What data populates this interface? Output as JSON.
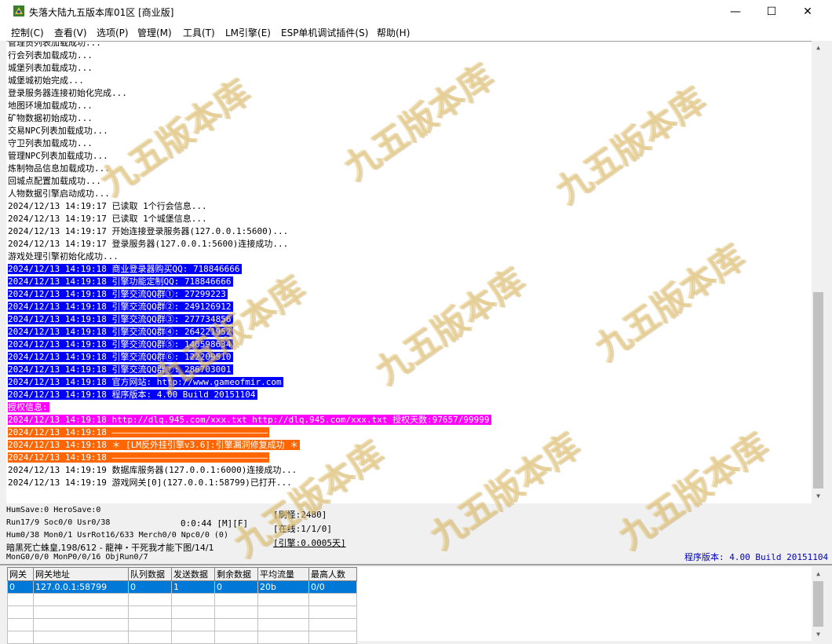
{
  "window": {
    "title": "失落大陆九五版本库01区 [商业版]",
    "controls": {
      "minimize": "—",
      "maximize": "☐",
      "close": "✕"
    }
  },
  "menu": [
    "控制(C)",
    "查看(V)",
    "选项(P)",
    "管理(M)",
    "工具(T)",
    "LM引擎(E)",
    "ESP单机调试插件(S)",
    "帮助(H)"
  ],
  "log": [
    {
      "text": "管理员列表加载成功...",
      "style": "normal"
    },
    {
      "text": "行会列表加载成功...",
      "style": "normal"
    },
    {
      "text": "城堡列表加载成功...",
      "style": "normal"
    },
    {
      "text": "城堡城初始完成...",
      "style": "normal"
    },
    {
      "text": "登录服务器连接初始化完成...",
      "style": "normal"
    },
    {
      "text": "地图环境加载成功...",
      "style": "normal"
    },
    {
      "text": "矿物数据初始成功...",
      "style": "normal"
    },
    {
      "text": "交易NPC列表加载成功...",
      "style": "normal"
    },
    {
      "text": "守卫列表加载成功...",
      "style": "normal"
    },
    {
      "text": "管理NPC列表加载成功...",
      "style": "normal"
    },
    {
      "text": "炼制物品信息加载成功...",
      "style": "normal"
    },
    {
      "text": "回城点配置加载成功...",
      "style": "normal"
    },
    {
      "text": "人物数据引擎启动成功...",
      "style": "normal"
    },
    {
      "text": "2024/12/13 14:19:17 已读取 1个行会信息...",
      "style": "normal"
    },
    {
      "text": "2024/12/13 14:19:17 已读取 1个城堡信息...",
      "style": "normal"
    },
    {
      "text": "2024/12/13 14:19:17 开始连接登录服务器(127.0.0.1:5600)...",
      "style": "normal"
    },
    {
      "text": "2024/12/13 14:19:17 登录服务器(127.0.0.1:5600)连接成功...",
      "style": "normal"
    },
    {
      "text": "游戏处理引擎初始化成功...",
      "style": "normal"
    },
    {
      "text": "2024/12/13 14:19:18 商业登录器购买QQ: 718846666",
      "style": "blue"
    },
    {
      "text": "2024/12/13 14:19:18 引擎功能定制QQ: 718846666",
      "style": "blue"
    },
    {
      "text": "2024/12/13 14:19:18 引擎交流QQ群①: 27299223",
      "style": "blue"
    },
    {
      "text": "2024/12/13 14:19:18 引擎交流QQ群②: 249126912",
      "style": "blue"
    },
    {
      "text": "2024/12/13 14:19:18 引擎交流QQ群③: 277734856",
      "style": "blue"
    },
    {
      "text": "2024/12/13 14:19:18 引擎交流QQ群④: 264221952",
      "style": "blue"
    },
    {
      "text": "2024/12/13 14:19:18 引擎交流QQ群⑤: 140598634",
      "style": "blue"
    },
    {
      "text": "2024/12/13 14:19:18 引擎交流QQ群⑥: 122209510",
      "style": "blue"
    },
    {
      "text": "2024/12/13 14:19:18 引擎交流QQ群⑦: 286703001",
      "style": "blue"
    },
    {
      "text": "2024/12/13 14:19:18 官方网站: http://www.gameofmir.com",
      "style": "blue"
    },
    {
      "text": "2024/12/13 14:19:18 程序版本: 4.00 Build 20151104",
      "style": "blue"
    },
    {
      "text": "授权信息:",
      "style": "magenta"
    },
    {
      "text": "2024/12/13 14:19:18 http://dlq.945.com/xxx.txt http://dlq.945.com/xxx.txt 授权天数:97657/99999",
      "style": "magenta"
    },
    {
      "text": "2024/12/13 14:19:18 ——————————————————————————————",
      "style": "orange"
    },
    {
      "text": "2024/12/13 14:19:18 ＊ [LM反外挂引擎v3.6]:引擎漏洞修复成功 ＊",
      "style": "orange"
    },
    {
      "text": "2024/12/13 14:19:18 ——————————————————————————————",
      "style": "orange"
    },
    {
      "text": "2024/12/13 14:19:19 数据库服务器(127.0.0.1:6000)连接成功...",
      "style": "normal"
    },
    {
      "text": "2024/12/13 14:19:19 游戏网关[0](127.0.0.1:58799)已打开...",
      "style": "normal"
    }
  ],
  "status": {
    "line1": "HumSave:0 HeroSave:0",
    "line2": "Run17/9 Soc0/0 Usr0/38",
    "timer": "0:0:44 [M][F]",
    "line3": "Hum0/38 Mon0/1 UsrRot16/633 Merch0/0 Npc0/0 (0)",
    "line4": "暗黑死亡蛛皇,198/612 - 龍神・干死我才能下图/14/1",
    "line5": "MonG0/0/0 MonP0/0/16 ObjRun0/7",
    "refresh": "[刷怪:2480]",
    "online": "[在线:1/1/0]",
    "engine": "[引擎:0.0005天]",
    "version": "程序版本: 4.00 Build 20151104"
  },
  "gateway_table": {
    "headers": [
      "网关",
      "网关地址",
      "队列数据",
      "发送数据",
      "剩余数据",
      "平均流量",
      "最高人数"
    ],
    "rows": [
      [
        "0",
        "127.0.0.1:58799",
        "0",
        "1",
        "0",
        "20b",
        "0/0"
      ]
    ]
  },
  "watermark_text": "九五版本库",
  "colors": {
    "highlight_blue": "#0000ff",
    "highlight_magenta": "#ff00ff",
    "highlight_orange": "#ff6600",
    "version_text": "#0000c0"
  }
}
